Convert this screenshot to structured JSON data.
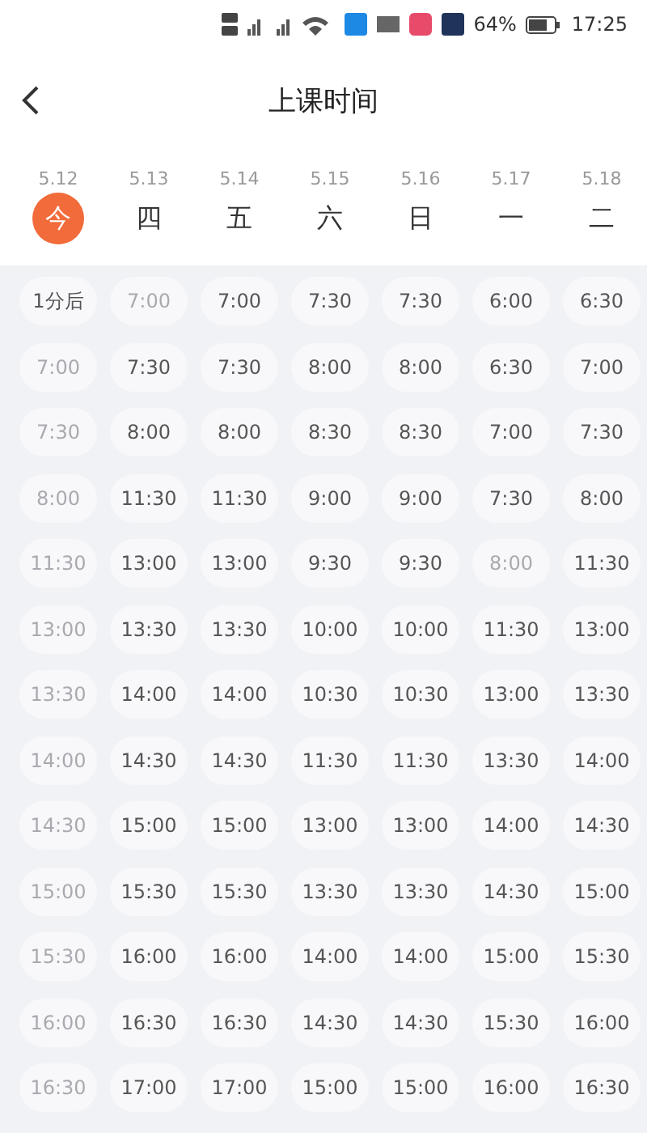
{
  "status_bar": {
    "battery": "64%",
    "time": "17:25"
  },
  "header": {
    "title": "上课时间"
  },
  "days": [
    {
      "date": "5.12",
      "weekday": "今",
      "selected": true
    },
    {
      "date": "5.13",
      "weekday": "四",
      "selected": false
    },
    {
      "date": "5.14",
      "weekday": "五",
      "selected": false
    },
    {
      "date": "5.15",
      "weekday": "六",
      "selected": false
    },
    {
      "date": "5.16",
      "weekday": "日",
      "selected": false
    },
    {
      "date": "5.17",
      "weekday": "一",
      "selected": false
    },
    {
      "date": "5.18",
      "weekday": "二",
      "selected": false
    }
  ],
  "rows": [
    [
      {
        "text": "1分后",
        "disabled": false
      },
      {
        "text": "7:00",
        "disabled": true
      },
      {
        "text": "7:00",
        "disabled": false
      },
      {
        "text": "7:30",
        "disabled": false
      },
      {
        "text": "7:30",
        "disabled": false
      },
      {
        "text": "6:00",
        "disabled": false
      },
      {
        "text": "6:30",
        "disabled": false
      }
    ],
    [
      {
        "text": "7:00",
        "disabled": true
      },
      {
        "text": "7:30",
        "disabled": false
      },
      {
        "text": "7:30",
        "disabled": false
      },
      {
        "text": "8:00",
        "disabled": false
      },
      {
        "text": "8:00",
        "disabled": false
      },
      {
        "text": "6:30",
        "disabled": false
      },
      {
        "text": "7:00",
        "disabled": false
      }
    ],
    [
      {
        "text": "7:30",
        "disabled": true
      },
      {
        "text": "8:00",
        "disabled": false
      },
      {
        "text": "8:00",
        "disabled": false
      },
      {
        "text": "8:30",
        "disabled": false
      },
      {
        "text": "8:30",
        "disabled": false
      },
      {
        "text": "7:00",
        "disabled": false
      },
      {
        "text": "7:30",
        "disabled": false
      }
    ],
    [
      {
        "text": "8:00",
        "disabled": true
      },
      {
        "text": "11:30",
        "disabled": false
      },
      {
        "text": "11:30",
        "disabled": false
      },
      {
        "text": "9:00",
        "disabled": false
      },
      {
        "text": "9:00",
        "disabled": false
      },
      {
        "text": "7:30",
        "disabled": false
      },
      {
        "text": "8:00",
        "disabled": false
      }
    ],
    [
      {
        "text": "11:30",
        "disabled": true
      },
      {
        "text": "13:00",
        "disabled": false
      },
      {
        "text": "13:00",
        "disabled": false
      },
      {
        "text": "9:30",
        "disabled": false
      },
      {
        "text": "9:30",
        "disabled": false
      },
      {
        "text": "8:00",
        "disabled": true
      },
      {
        "text": "11:30",
        "disabled": false
      }
    ],
    [
      {
        "text": "13:00",
        "disabled": true
      },
      {
        "text": "13:30",
        "disabled": false
      },
      {
        "text": "13:30",
        "disabled": false
      },
      {
        "text": "10:00",
        "disabled": false
      },
      {
        "text": "10:00",
        "disabled": false
      },
      {
        "text": "11:30",
        "disabled": false
      },
      {
        "text": "13:00",
        "disabled": false
      }
    ],
    [
      {
        "text": "13:30",
        "disabled": true
      },
      {
        "text": "14:00",
        "disabled": false
      },
      {
        "text": "14:00",
        "disabled": false
      },
      {
        "text": "10:30",
        "disabled": false
      },
      {
        "text": "10:30",
        "disabled": false
      },
      {
        "text": "13:00",
        "disabled": false
      },
      {
        "text": "13:30",
        "disabled": false
      }
    ],
    [
      {
        "text": "14:00",
        "disabled": true
      },
      {
        "text": "14:30",
        "disabled": false
      },
      {
        "text": "14:30",
        "disabled": false
      },
      {
        "text": "11:30",
        "disabled": false
      },
      {
        "text": "11:30",
        "disabled": false
      },
      {
        "text": "13:30",
        "disabled": false
      },
      {
        "text": "14:00",
        "disabled": false
      }
    ],
    [
      {
        "text": "14:30",
        "disabled": true
      },
      {
        "text": "15:00",
        "disabled": false
      },
      {
        "text": "15:00",
        "disabled": false
      },
      {
        "text": "13:00",
        "disabled": false
      },
      {
        "text": "13:00",
        "disabled": false
      },
      {
        "text": "14:00",
        "disabled": false
      },
      {
        "text": "14:30",
        "disabled": false
      }
    ],
    [
      {
        "text": "15:00",
        "disabled": true
      },
      {
        "text": "15:30",
        "disabled": false
      },
      {
        "text": "15:30",
        "disabled": false
      },
      {
        "text": "13:30",
        "disabled": false
      },
      {
        "text": "13:30",
        "disabled": false
      },
      {
        "text": "14:30",
        "disabled": false
      },
      {
        "text": "15:00",
        "disabled": false
      }
    ],
    [
      {
        "text": "15:30",
        "disabled": true
      },
      {
        "text": "16:00",
        "disabled": false
      },
      {
        "text": "16:00",
        "disabled": false
      },
      {
        "text": "14:00",
        "disabled": false
      },
      {
        "text": "14:00",
        "disabled": false
      },
      {
        "text": "15:00",
        "disabled": false
      },
      {
        "text": "15:30",
        "disabled": false
      }
    ],
    [
      {
        "text": "16:00",
        "disabled": true
      },
      {
        "text": "16:30",
        "disabled": false
      },
      {
        "text": "16:30",
        "disabled": false
      },
      {
        "text": "14:30",
        "disabled": false
      },
      {
        "text": "14:30",
        "disabled": false
      },
      {
        "text": "15:30",
        "disabled": false
      },
      {
        "text": "16:00",
        "disabled": false
      }
    ],
    [
      {
        "text": "16:30",
        "disabled": true
      },
      {
        "text": "17:00",
        "disabled": false
      },
      {
        "text": "17:00",
        "disabled": false
      },
      {
        "text": "15:00",
        "disabled": false
      },
      {
        "text": "15:00",
        "disabled": false
      },
      {
        "text": "16:00",
        "disabled": false
      },
      {
        "text": "16:30",
        "disabled": false
      }
    ]
  ]
}
